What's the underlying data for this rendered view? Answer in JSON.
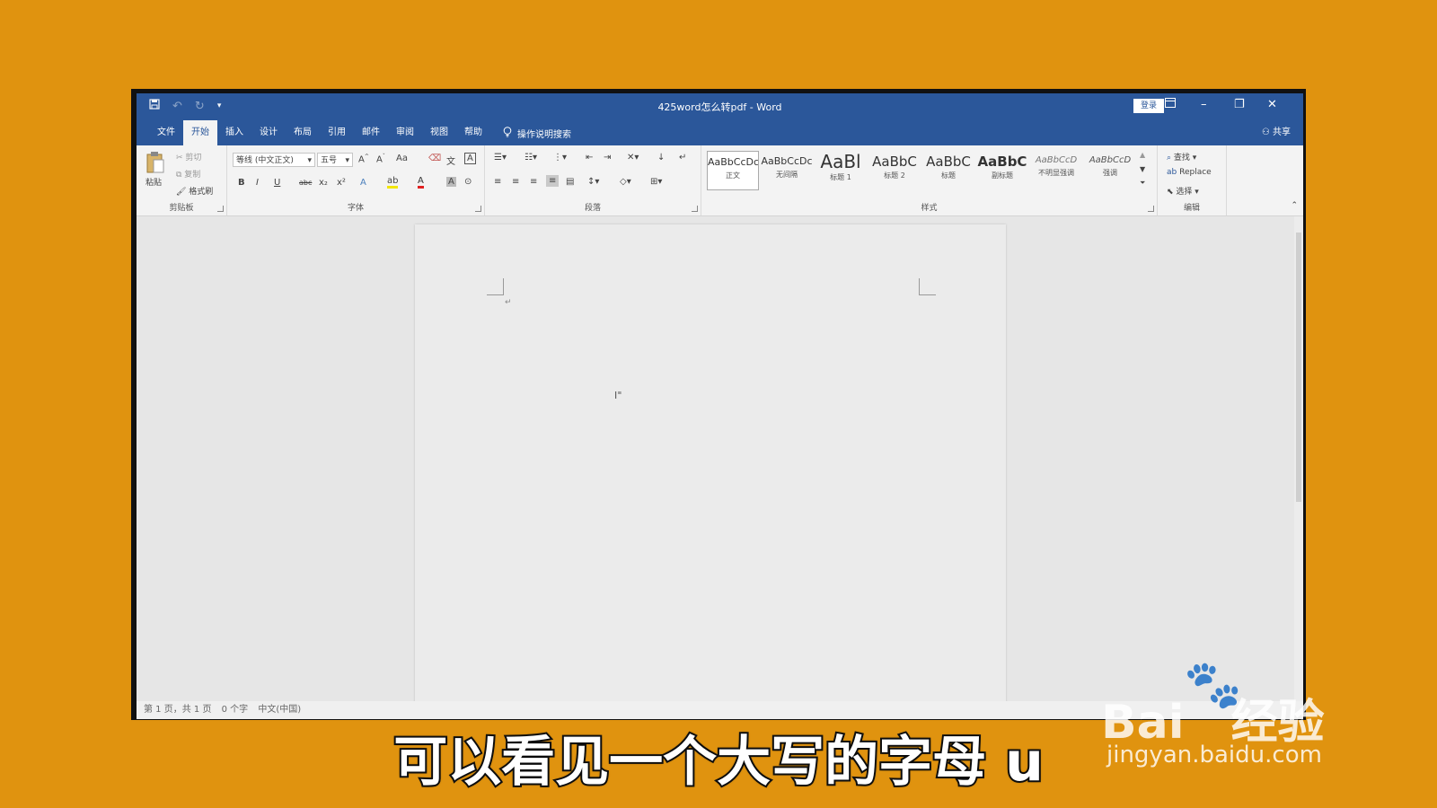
{
  "window": {
    "title": "425word怎么转pdf - Word",
    "login_label": "登录",
    "share_label": "共享"
  },
  "qat": {
    "save_icon": "save-icon",
    "undo_icon": "undo-icon",
    "redo_icon": "redo-icon"
  },
  "tabs": [
    {
      "label": "文件"
    },
    {
      "label": "开始"
    },
    {
      "label": "插入"
    },
    {
      "label": "设计"
    },
    {
      "label": "布局"
    },
    {
      "label": "引用"
    },
    {
      "label": "邮件"
    },
    {
      "label": "审阅"
    },
    {
      "label": "视图"
    },
    {
      "label": "帮助"
    }
  ],
  "tell_me": "操作说明搜索",
  "clipboard": {
    "paste": "粘贴",
    "cut": "剪切",
    "copy": "复制",
    "format_painter": "格式刷",
    "group": "剪贴板"
  },
  "font": {
    "name": "等线 (中文正文)",
    "size": "五号",
    "group": "字体",
    "change_case": "Aa",
    "bold": "B",
    "italic": "I",
    "underline": "U",
    "strike": "abc",
    "subscript": "x₂",
    "superscript": "x²"
  },
  "paragraph": {
    "group": "段落"
  },
  "styles": {
    "group": "样式",
    "items": [
      {
        "sample": "AaBbCcDc",
        "name": "正文"
      },
      {
        "sample": "AaBbCcDc",
        "name": "无间隔"
      },
      {
        "sample": "AaBl",
        "name": "标题 1"
      },
      {
        "sample": "AaBbC",
        "name": "标题 2"
      },
      {
        "sample": "AaBbC",
        "name": "标题"
      },
      {
        "sample": "AaBbC",
        "name": "副标题"
      },
      {
        "sample": "AaBbCcD",
        "name": "不明显强调"
      },
      {
        "sample": "AaBbCcD",
        "name": "强调"
      }
    ]
  },
  "editing": {
    "find": "查找",
    "replace": "Replace",
    "select": "选择",
    "group": "编辑"
  },
  "status": {
    "page": "第 1 页，共 1 页",
    "words": "0 个字",
    "language": "中文(中国)"
  },
  "subtitle": "可以看见一个大写的字母 u",
  "watermark": {
    "brand": "Bai",
    "brand2": "经验",
    "domain": "jingyan.baidu.com"
  }
}
